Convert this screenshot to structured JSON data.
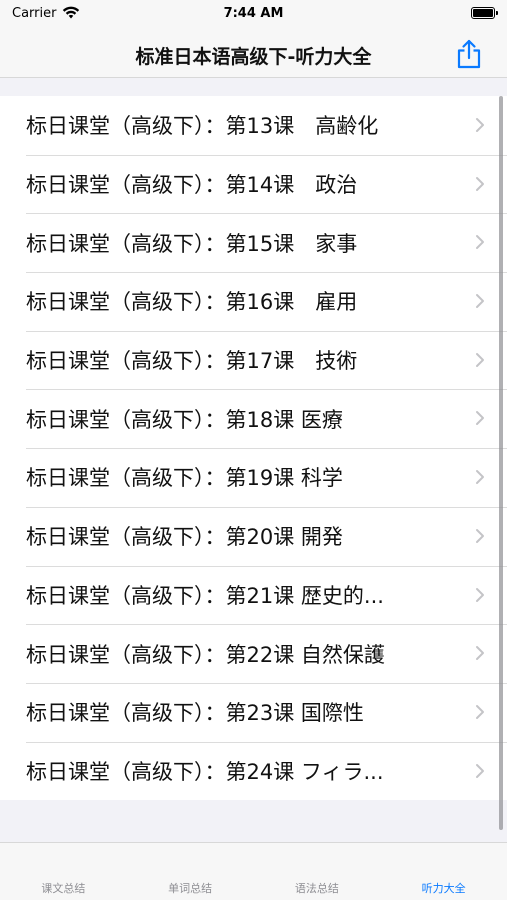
{
  "status_bar": {
    "carrier": "Carrier",
    "time": "7:44 AM"
  },
  "nav": {
    "title": "标准日本语高级下-听力大全",
    "share_icon": "share-icon",
    "accent_color": "#0a7aff"
  },
  "list": {
    "items": [
      "标日课堂（高级下）：第13课　高齢化",
      "标日课堂（高级下）：第14课　政治",
      "标日课堂（高级下）：第15课　家事",
      "标日课堂（高级下）：第16课　雇用",
      "标日课堂（高级下）：第17课　技術",
      "标日课堂（高级下）：第18课 医療",
      "标日课堂（高级下）：第19课 科学",
      "标日课堂（高级下）：第20课 開発",
      "标日课堂（高级下）：第21课 歴史的...",
      "标日课堂（高级下）：第22课 自然保護",
      "标日课堂（高级下）：第23课 国際性",
      "标日课堂（高级下）：第24课 フィラ..."
    ]
  },
  "tabs": [
    {
      "label": "课文总结",
      "active": false
    },
    {
      "label": "单词总结",
      "active": false
    },
    {
      "label": "语法总结",
      "active": false
    },
    {
      "label": "听力大全",
      "active": true
    }
  ]
}
